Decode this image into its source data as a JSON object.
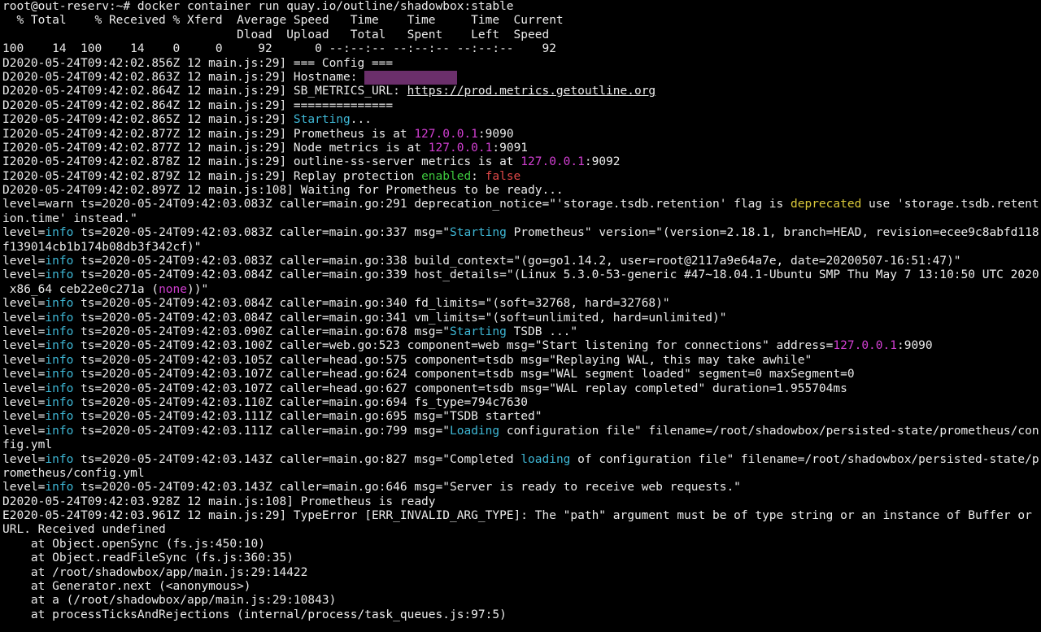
{
  "terminal": {
    "lines": [
      [
        {
          "t": "root@out-reserv:~# docker container run quay.io/outline/shadowbox:stable"
        }
      ],
      [
        {
          "t": "  % Total    % Received % Xferd  Average Speed   Time    Time     Time  Current"
        }
      ],
      [
        {
          "t": "                                 Dload  Upload   Total   Spent    Left  Speed"
        }
      ],
      [
        {
          "t": "100    14  100    14    0     0     92      0 --:--:-- --:--:-- --:--:--    92"
        }
      ],
      [
        {
          "t": "D2020-05-24T09:42:02.856Z 12 main.js:29] === Config ==="
        }
      ],
      [
        {
          "t": "D2020-05-24T09:42:02.863Z 12 main.js:29] Hostname: "
        },
        {
          "t": "             ",
          "c": "redact"
        }
      ],
      [
        {
          "t": "D2020-05-24T09:42:02.864Z 12 main.js:29] SB_METRICS_URL: "
        },
        {
          "t": "https://prod.metrics.getoutline.org",
          "c": "u"
        }
      ],
      [
        {
          "t": "D2020-05-24T09:42:02.864Z 12 main.js:29] =============="
        }
      ],
      [
        {
          "t": "I2020-05-24T09:42:02.865Z 12 main.js:29] "
        },
        {
          "t": "Starting",
          "c": "c-cyan"
        },
        {
          "t": "..."
        }
      ],
      [
        {
          "t": "I2020-05-24T09:42:02.877Z 12 main.js:29] Prometheus is at "
        },
        {
          "t": "127.0.0.1",
          "c": "c-magenta"
        },
        {
          "t": ":9090"
        }
      ],
      [
        {
          "t": "I2020-05-24T09:42:02.877Z 12 main.js:29] Node metrics is at "
        },
        {
          "t": "127.0.0.1",
          "c": "c-magenta"
        },
        {
          "t": ":9091"
        }
      ],
      [
        {
          "t": "I2020-05-24T09:42:02.878Z 12 main.js:29] outline-ss-server metrics is at "
        },
        {
          "t": "127.0.0.1",
          "c": "c-magenta"
        },
        {
          "t": ":9092"
        }
      ],
      [
        {
          "t": "I2020-05-24T09:42:02.879Z 12 main.js:29] Replay protection "
        },
        {
          "t": "enabled",
          "c": "c-green"
        },
        {
          "t": ": "
        },
        {
          "t": "false",
          "c": "c-red"
        }
      ],
      [
        {
          "t": "D2020-05-24T09:42:02.897Z 12 main.js:108] Waiting for Prometheus to be ready..."
        }
      ],
      [
        {
          "t": "level=warn ts=2020-05-24T09:42:03.083Z caller=main.go:291 deprecation_notice=\"'storage.tsdb.retention' flag is "
        },
        {
          "t": "deprecated",
          "c": "c-yellow"
        },
        {
          "t": " use 'storage.tsdb.retent"
        }
      ],
      [
        {
          "t": "ion.time' instead.\""
        }
      ],
      [
        {
          "t": "level="
        },
        {
          "t": "info",
          "c": "c-cyan"
        },
        {
          "t": " ts=2020-05-24T09:42:03.083Z caller=main.go:337 msg=\""
        },
        {
          "t": "Starting",
          "c": "c-cyan"
        },
        {
          "t": " Prometheus\" version=\"(version=2.18.1, branch=HEAD, revision=ecee9c8abfd118"
        }
      ],
      [
        {
          "t": "f139014cb1b174b08db3f342cf)\""
        }
      ],
      [
        {
          "t": "level="
        },
        {
          "t": "info",
          "c": "c-cyan"
        },
        {
          "t": " ts=2020-05-24T09:42:03.083Z caller=main.go:338 build_context=\"(go=go1.14.2, user=root@2117a9e64a7e, date=20200507-16:51:47)\""
        }
      ],
      [
        {
          "t": "level="
        },
        {
          "t": "info",
          "c": "c-cyan"
        },
        {
          "t": " ts=2020-05-24T09:42:03.084Z caller=main.go:339 host_details=\"(Linux 5.3.0-53-generic #47~18.04.1-Ubuntu SMP Thu May 7 13:10:50 UTC 2020"
        }
      ],
      [
        {
          "t": " x86_64 ceb22e0c271a ("
        },
        {
          "t": "none",
          "c": "c-magenta"
        },
        {
          "t": "))\""
        }
      ],
      [
        {
          "t": "level="
        },
        {
          "t": "info",
          "c": "c-cyan"
        },
        {
          "t": " ts=2020-05-24T09:42:03.084Z caller=main.go:340 fd_limits=\"(soft=32768, hard=32768)\""
        }
      ],
      [
        {
          "t": "level="
        },
        {
          "t": "info",
          "c": "c-cyan"
        },
        {
          "t": " ts=2020-05-24T09:42:03.084Z caller=main.go:341 vm_limits=\"(soft=unlimited, hard=unlimited)\""
        }
      ],
      [
        {
          "t": "level="
        },
        {
          "t": "info",
          "c": "c-cyan"
        },
        {
          "t": " ts=2020-05-24T09:42:03.090Z caller=main.go:678 msg=\""
        },
        {
          "t": "Starting",
          "c": "c-cyan"
        },
        {
          "t": " TSDB ...\""
        }
      ],
      [
        {
          "t": "level="
        },
        {
          "t": "info",
          "c": "c-cyan"
        },
        {
          "t": " ts=2020-05-24T09:42:03.100Z caller=web.go:523 component=web msg=\"Start listening for connections\" address="
        },
        {
          "t": "127.0.0.1",
          "c": "c-magenta"
        },
        {
          "t": ":9090"
        }
      ],
      [
        {
          "t": "level="
        },
        {
          "t": "info",
          "c": "c-cyan"
        },
        {
          "t": " ts=2020-05-24T09:42:03.105Z caller=head.go:575 component=tsdb msg=\"Replaying WAL, this may take awhile\""
        }
      ],
      [
        {
          "t": "level="
        },
        {
          "t": "info",
          "c": "c-cyan"
        },
        {
          "t": " ts=2020-05-24T09:42:03.107Z caller=head.go:624 component=tsdb msg=\"WAL segment loaded\" segment=0 maxSegment=0"
        }
      ],
      [
        {
          "t": "level="
        },
        {
          "t": "info",
          "c": "c-cyan"
        },
        {
          "t": " ts=2020-05-24T09:42:03.107Z caller=head.go:627 component=tsdb msg=\"WAL replay completed\" duration=1.955704ms"
        }
      ],
      [
        {
          "t": "level="
        },
        {
          "t": "info",
          "c": "c-cyan"
        },
        {
          "t": " ts=2020-05-24T09:42:03.110Z caller=main.go:694 fs_type=794c7630"
        }
      ],
      [
        {
          "t": "level="
        },
        {
          "t": "info",
          "c": "c-cyan"
        },
        {
          "t": " ts=2020-05-24T09:42:03.111Z caller=main.go:695 msg=\"TSDB started\""
        }
      ],
      [
        {
          "t": "level="
        },
        {
          "t": "info",
          "c": "c-cyan"
        },
        {
          "t": " ts=2020-05-24T09:42:03.111Z caller=main.go:799 msg=\""
        },
        {
          "t": "Loading",
          "c": "c-cyan"
        },
        {
          "t": " configuration file\" filename=/root/shadowbox/persisted-state/prometheus/con"
        }
      ],
      [
        {
          "t": "fig.yml"
        }
      ],
      [
        {
          "t": "level="
        },
        {
          "t": "info",
          "c": "c-cyan"
        },
        {
          "t": " ts=2020-05-24T09:42:03.143Z caller=main.go:827 msg=\"Completed "
        },
        {
          "t": "loading",
          "c": "c-cyan"
        },
        {
          "t": " of configuration file\" filename=/root/shadowbox/persisted-state/p"
        }
      ],
      [
        {
          "t": "rometheus/config.yml"
        }
      ],
      [
        {
          "t": "level="
        },
        {
          "t": "info",
          "c": "c-cyan"
        },
        {
          "t": " ts=2020-05-24T09:42:03.143Z caller=main.go:646 msg=\"Server is ready to receive web requests.\""
        }
      ],
      [
        {
          "t": "D2020-05-24T09:42:03.928Z 12 main.js:108] Prometheus is ready"
        }
      ],
      [
        {
          "t": "E2020-05-24T09:42:03.961Z 12 main.js:29] TypeError [ERR_INVALID_ARG_TYPE]: The \"path\" argument must be of type string or an instance of Buffer or"
        }
      ],
      [
        {
          "t": "URL. Received undefined"
        }
      ],
      [
        {
          "t": "    at Object.openSync (fs.js:450:10)"
        }
      ],
      [
        {
          "t": "    at Object.readFileSync (fs.js:360:35)"
        }
      ],
      [
        {
          "t": "    at /root/shadowbox/app/main.js:29:14422"
        }
      ],
      [
        {
          "t": "    at Generator.next (<anonymous>)"
        }
      ],
      [
        {
          "t": "    at a (/root/shadowbox/app/main.js:29:10843)"
        }
      ],
      [
        {
          "t": "    at processTicksAndRejections (internal/process/task_queues.js:97:5)"
        }
      ]
    ]
  }
}
